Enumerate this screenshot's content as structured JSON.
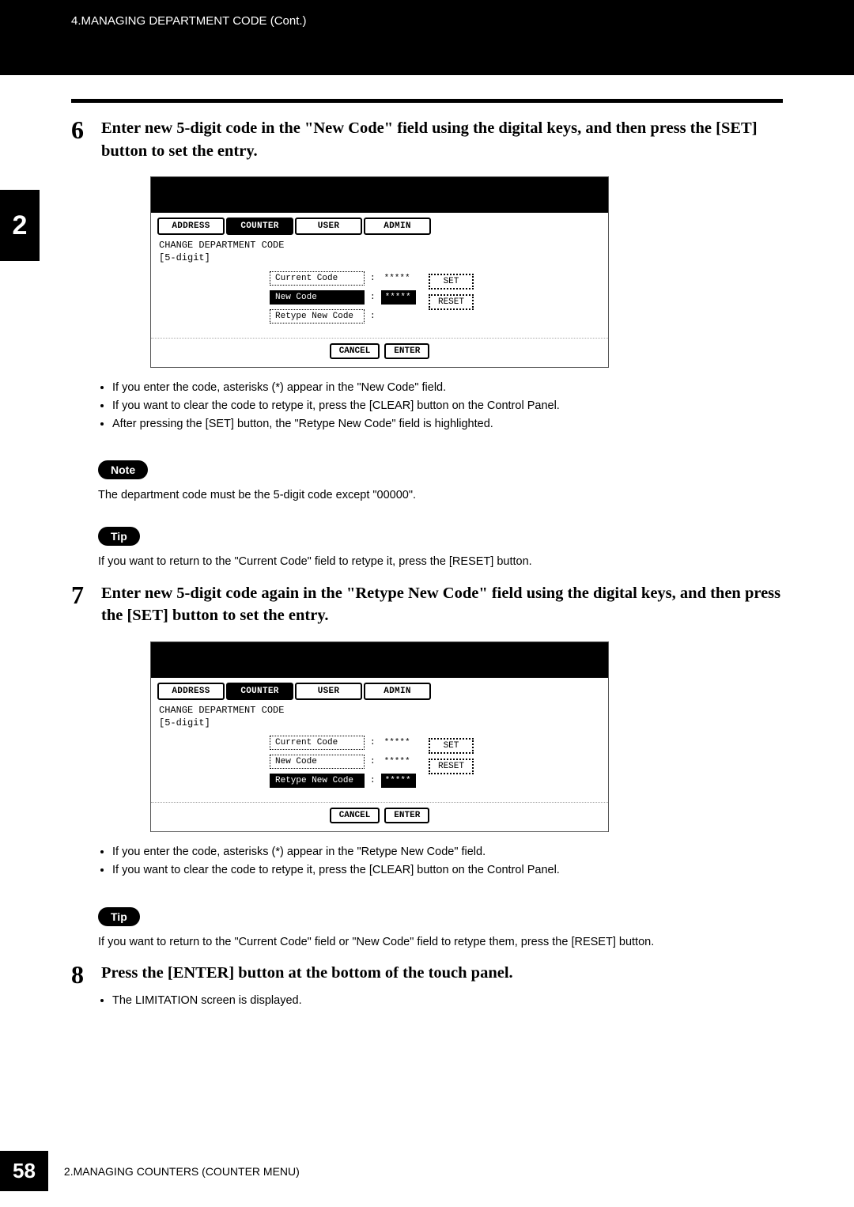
{
  "header": {
    "title": "4.MANAGING DEPARTMENT CODE (Cont.)"
  },
  "chapter_tab": "2",
  "step6": {
    "number": "6",
    "text": "Enter new 5-digit code in the \"New Code\" field using the digital keys, and then press the [SET] button to set the entry.",
    "bullets": [
      "If you enter the code, asterisks (*) appear in the \"New Code\" field.",
      "If you want to clear the code to retype it, press the [CLEAR] button on the Control Panel.",
      "After pressing the [SET] button, the \"Retype New Code\" field is highlighted."
    ]
  },
  "note": {
    "label": "Note",
    "text": "The department code must be the 5-digit code except \"00000\"."
  },
  "tip1": {
    "label": "Tip",
    "text": "If you want to return to the \"Current Code\" field to retype it, press the [RESET] button."
  },
  "step7": {
    "number": "7",
    "text": "Enter new 5-digit code again in the \"Retype New Code\" field using the digital keys, and then press the [SET] button to set the entry.",
    "bullets": [
      "If you enter the code, asterisks (*) appear in the \"Retype New Code\" field.",
      "If you want to clear the code to retype it, press the [CLEAR] button on the Control Panel."
    ]
  },
  "tip2": {
    "label": "Tip",
    "text": "If you want to return to the \"Current Code\" field or \"New Code\" field to retype them, press the [RESET] button."
  },
  "step8": {
    "number": "8",
    "text": "Press the [ENTER] button at the bottom of the touch panel.",
    "bullets": [
      "The LIMITATION screen is displayed."
    ]
  },
  "screen": {
    "tabs": {
      "address": "ADDRESS",
      "counter": "COUNTER",
      "user": "USER",
      "admin": "ADMIN"
    },
    "title": "CHANGE DEPARTMENT CODE",
    "subtitle": "[5-digit]",
    "fields": {
      "current": "Current Code",
      "new": "New Code",
      "retype": "Retype New Code"
    },
    "masked": "*****",
    "set": "SET",
    "reset": "RESET",
    "cancel": "CANCEL",
    "enter": "ENTER"
  },
  "footer": {
    "page": "58",
    "text": "2.MANAGING COUNTERS (COUNTER MENU)"
  }
}
